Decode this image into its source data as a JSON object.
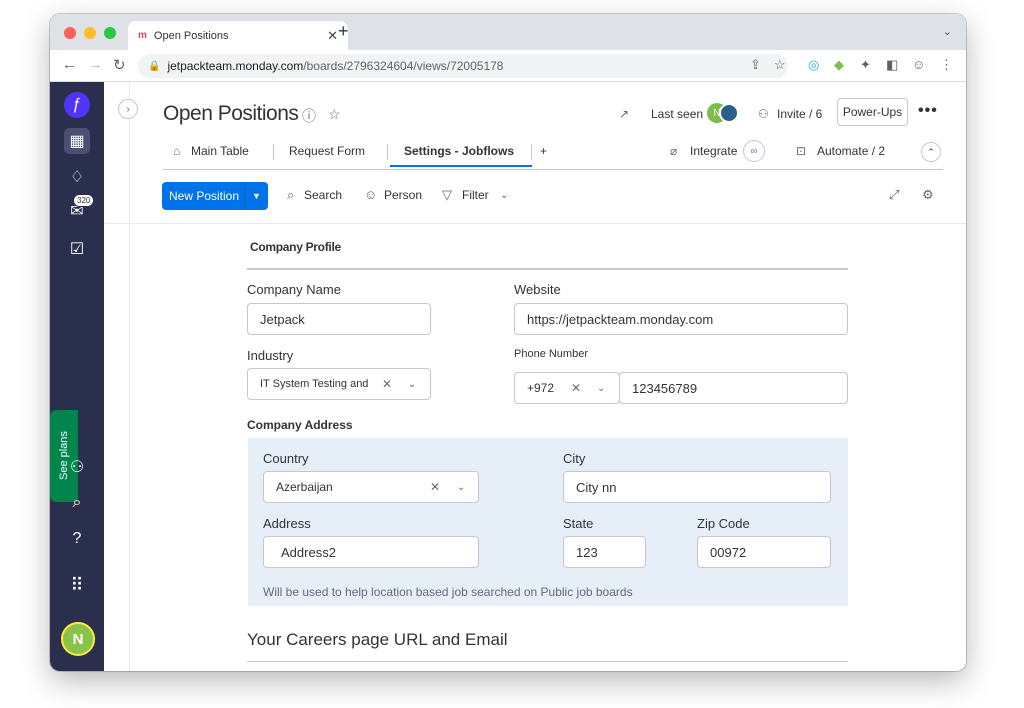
{
  "browser": {
    "tab_title": "Open Positions",
    "tab_logo": "m",
    "new_tab": "+",
    "url_domain": "jetpackteam.monday.com",
    "url_path": "/boards/2796324604/views/72005178"
  },
  "sidebar": {
    "notifications_count": "320",
    "see_plans": "See plans",
    "avatar_initial": "N"
  },
  "header": {
    "title": "Open Positions",
    "last_seen": "Last seen",
    "invite": "Invite / 6",
    "power_ups": "Power-Ups",
    "more": "•••",
    "seen_avatar_initial": "N"
  },
  "views": {
    "tabs": [
      {
        "label": "Main Table"
      },
      {
        "label": "Request Form"
      },
      {
        "label": "Settings - Jobflows"
      }
    ],
    "add_view": "+",
    "integrate": "Integrate",
    "automate": "Automate / 2"
  },
  "toolbar": {
    "new_position": "New Position",
    "search": "Search",
    "person": "Person",
    "filter": "Filter"
  },
  "form": {
    "section_title": "Company Profile",
    "company_name_label": "Company Name",
    "company_name_value": "Jetpack",
    "website_label": "Website",
    "website_value": "https://jetpackteam.monday.com",
    "industry_label": "Industry",
    "industry_value": "IT System Testing and",
    "phone_label": "Phone Number",
    "phone_code": "+972",
    "phone_value": "123456789",
    "address_section": "Company Address",
    "country_label": "Country",
    "country_value": "Azerbaijan",
    "city_label": "City",
    "city_value": "City nn",
    "address_label": "Address",
    "address_value": "Address2",
    "state_label": "State",
    "state_value": "123",
    "zip_label": "Zip Code",
    "zip_value": "00972",
    "helper_text": "Will be used to help location based job searched on Public job boards",
    "careers_title": "Your Careers page URL and Email"
  },
  "colors": {
    "primary": "#0073ea",
    "sidebar": "#292f4c",
    "see_plans": "#00854d",
    "address_bg": "#e6eef8"
  }
}
